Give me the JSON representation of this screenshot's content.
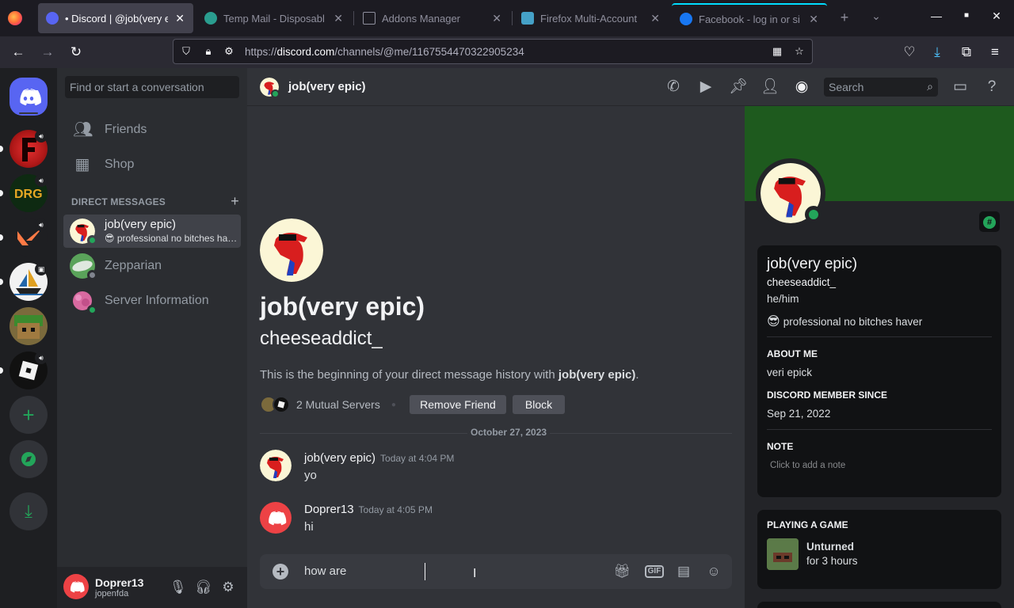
{
  "browser": {
    "tabs": [
      {
        "title": "• Discord | @job(very ep",
        "active": true
      },
      {
        "title": "Temp Mail - Disposabl",
        "active": false
      },
      {
        "title": "Addons Manager",
        "active": false
      },
      {
        "title": "Firefox Multi-Account",
        "active": false
      },
      {
        "title": "Facebook - log in or si",
        "active": false
      }
    ],
    "new_tab": "+",
    "url_host": "discord.com",
    "url_prefix": "https://",
    "url_path": "/channels/@me/1167554470322905234"
  },
  "dm_sidebar": {
    "search_placeholder": "Find or start a conversation",
    "friends_label": "Friends",
    "shop_label": "Shop",
    "dm_header": "DIRECT MESSAGES",
    "items": [
      {
        "name": "job(very epic)",
        "status": "😎 professional no bitches haver",
        "status_color": "#23a55a"
      },
      {
        "name": "Zepparian",
        "status": "",
        "status_color": "#80848e"
      },
      {
        "name": "Server Information",
        "status": "",
        "status_color": "#23a55a"
      }
    ]
  },
  "user_panel": {
    "username": "Doprer13",
    "tag": "jopenfda"
  },
  "header": {
    "title": "job(very epic)",
    "search_placeholder": "Search"
  },
  "intro": {
    "name": "job(very epic)",
    "username": "cheeseaddict_",
    "desc_prefix": "This is the beginning of your direct message history with ",
    "desc_name": "job(very epic)",
    "desc_suffix": ".",
    "mutual_servers": "2 Mutual Servers",
    "remove_friend": "Remove Friend",
    "block": "Block"
  },
  "messages": {
    "date_divider": "October 27, 2023",
    "list": [
      {
        "author": "job(very epic)",
        "time": "Today at 4:04 PM",
        "text": "yo"
      },
      {
        "author": "Doprer13",
        "time": "Today at 4:05 PM",
        "text": "hi"
      }
    ]
  },
  "composer": {
    "text": "how are",
    "gif_label": "GIF"
  },
  "profile": {
    "display_name": "job(very epic)",
    "username": "cheeseaddict_",
    "pronouns": "he/him",
    "custom_status": "professional no bitches haver",
    "about_header": "ABOUT ME",
    "about_text": "veri epick",
    "member_since_header": "DISCORD MEMBER SINCE",
    "member_since": "Sep 21, 2022",
    "note_header": "NOTE",
    "note_placeholder": "Click to add a note",
    "game_header": "PLAYING A GAME",
    "game_name": "Unturned",
    "game_time": "for 3 hours",
    "banner_color": "#1e5a1e"
  },
  "colors": {
    "online": "#23a55a",
    "discord_blurple": "#5865f2",
    "user_avatar_red": "#ed4245"
  }
}
